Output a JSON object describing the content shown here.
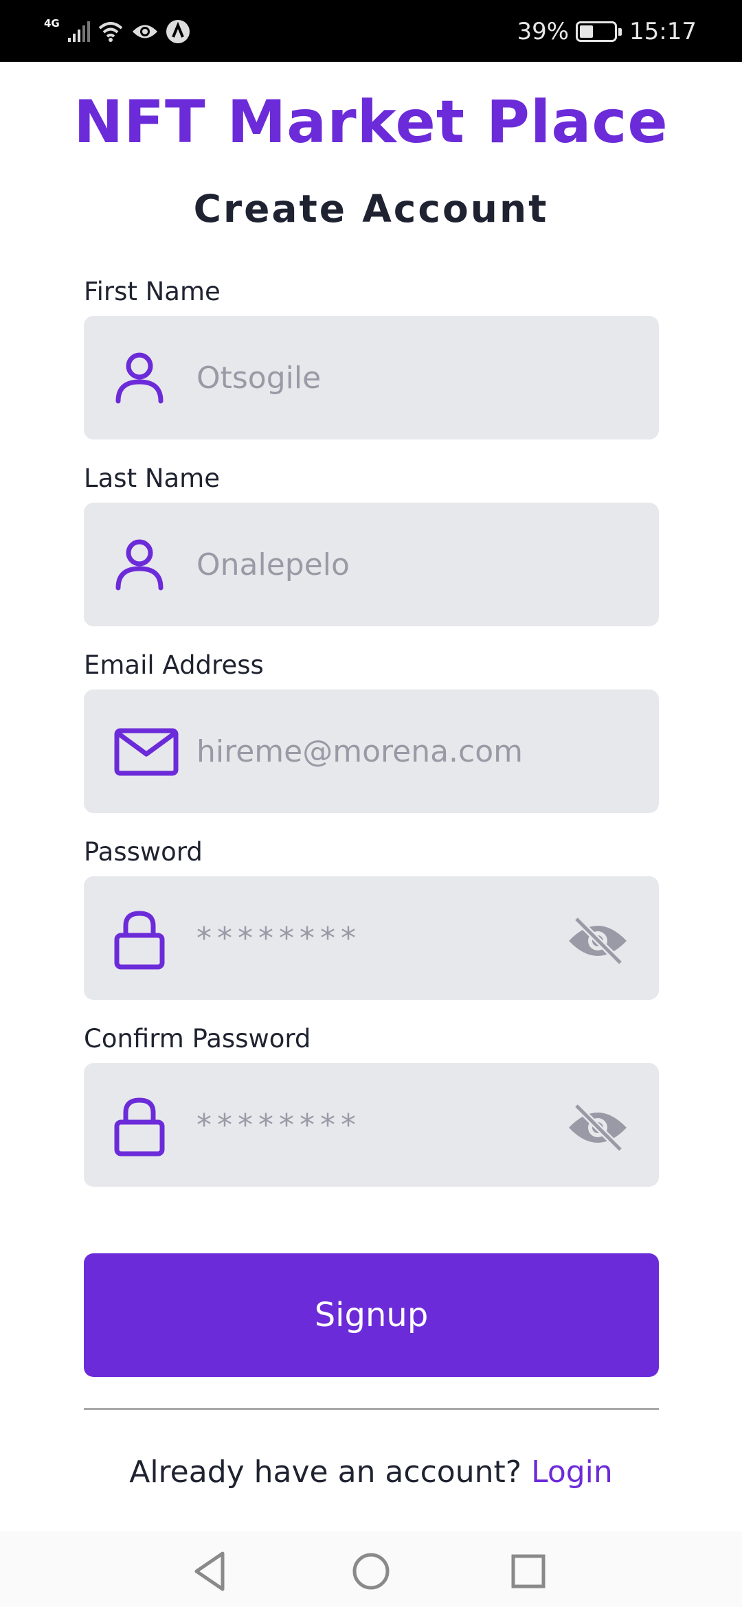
{
  "status_bar": {
    "network": "4G",
    "battery": "39%",
    "time": "15:17",
    "icons": [
      "signal-icon",
      "wifi-icon",
      "eye-icon",
      "app-notification-icon",
      "battery-icon"
    ]
  },
  "header": {
    "title": "NFT Market Place",
    "subtitle": "Create Account"
  },
  "form": {
    "first_name": {
      "label": "First Name",
      "placeholder": "Otsogile",
      "icon": "user-icon"
    },
    "last_name": {
      "label": "Last Name",
      "placeholder": "Onalepelo",
      "icon": "user-icon"
    },
    "email": {
      "label": "Email Address",
      "placeholder": "hireme@morena.com",
      "icon": "mail-icon"
    },
    "password": {
      "label": "Password",
      "placeholder": "********",
      "icon": "lock-icon",
      "toggle_icon": "eye-off-icon"
    },
    "confirm_password": {
      "label": "Confirm Password",
      "placeholder": "********",
      "icon": "lock-icon",
      "toggle_icon": "eye-off-icon"
    }
  },
  "actions": {
    "signup_label": "Signup",
    "login_prompt": "Already have an account? ",
    "login_link": "Login"
  },
  "colors": {
    "accent": "#6c2bd9",
    "field_bg": "#e7e8ec",
    "placeholder": "#9a9aa6"
  },
  "nav_bar": {
    "icons": [
      "back-icon",
      "home-icon",
      "recents-icon"
    ]
  }
}
